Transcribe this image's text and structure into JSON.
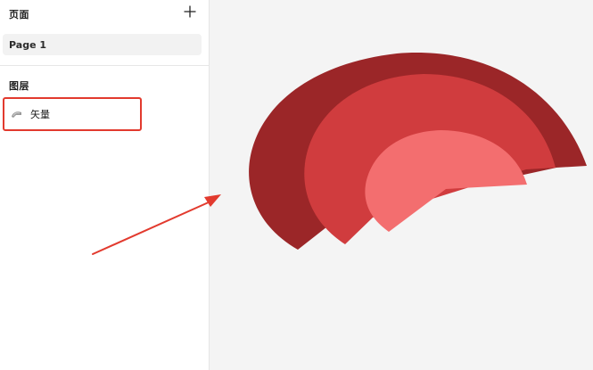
{
  "pages_panel": {
    "title": "页面",
    "add_icon": "plus-icon",
    "pages": [
      {
        "label": "Page 1",
        "selected": true
      }
    ]
  },
  "layers_panel": {
    "title": "图层",
    "layers": [
      {
        "label": "矢量",
        "icon": "vector-shape-icon",
        "highlighted": true
      }
    ]
  },
  "canvas": {
    "background_color": "#f4f4f4",
    "shape_colors": [
      "#9b2628",
      "#d03c3e",
      "#f36e6f"
    ]
  },
  "annotation": {
    "color": "#e23a2e"
  }
}
